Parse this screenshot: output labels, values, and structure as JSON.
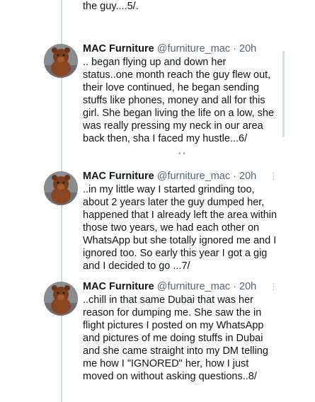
{
  "previous_tweet": {
    "text_tail": "the guy....5/."
  },
  "tweets": [
    {
      "author_name": "MAC Furniture",
      "handle": "@furniture_mac",
      "separator": "·",
      "time": "20h",
      "text": ".. began flying up and down her status..one month reach the guy flew out, their love continued, he began sending stuffs like phones, money and all for this girl. She began living the life on a low, she was really pressing my neck in our area back then, sha I faced my hustle...6/"
    },
    {
      "author_name": "MAC Furniture",
      "handle": "@furniture_mac",
      "separator": "·",
      "time": "20h",
      "text": "..in my little way I started grinding too, about 2 years later the guy dumped her, happened that I already left the area within those two years, we had each other on WhatsApp but she totally ignored me and I ignored too. So early this year I got a gig and I decided to go ...7/"
    },
    {
      "author_name": "MAC Furniture",
      "handle": "@furniture_mac",
      "separator": "·",
      "time": "20h",
      "text": "..chill in that same Dubai that was her reason for dumping me. She saw the in flight pictures I posted on my WhatsApp and pictures of me doing stuffs in Dubai and she came straight into my DM telling me how I \"IGNORED\" her, how I just moved on without asking questions..8/"
    }
  ],
  "icons": {
    "more": "more-options-icon",
    "avatar": "teddy-bear-avatar"
  },
  "colors": {
    "text": "#0f1419",
    "secondary": "#536471",
    "thread_line": "#cfd9de"
  }
}
